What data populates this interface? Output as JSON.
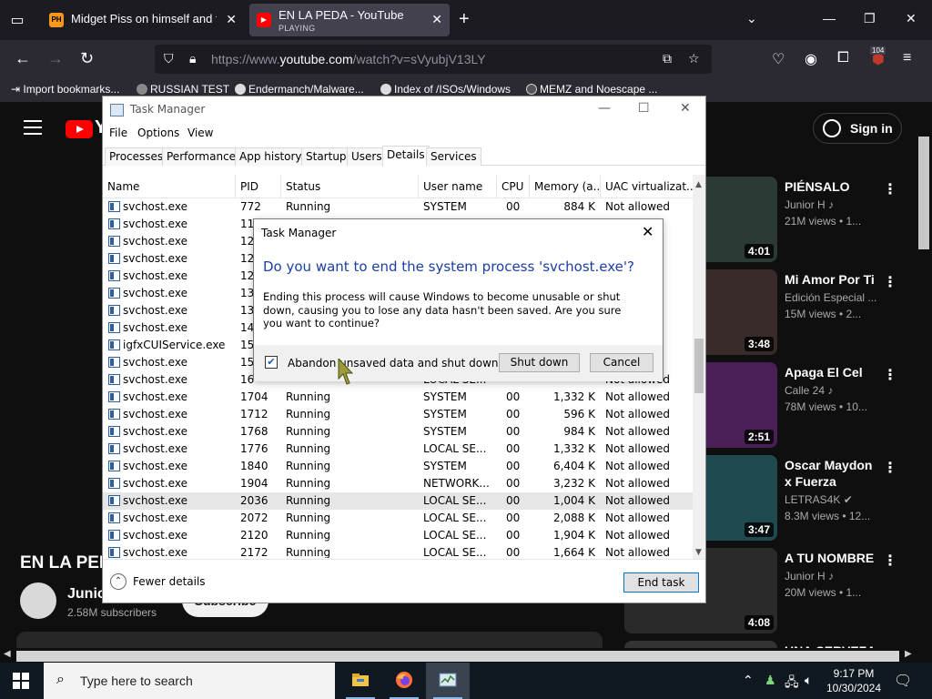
{
  "browser": {
    "tabs": [
      {
        "title": "Midget Piss on himself and their",
        "favicon": "PH",
        "playing": ""
      },
      {
        "title": "EN LA PEDA - YouTube",
        "favicon": "yt",
        "playing": "PLAYING"
      }
    ],
    "url_prefix": "https://www.",
    "url_domain": "youtube.com",
    "url_path": "/watch?v=sVyubjV13LY",
    "extension_badge": "104",
    "bookmarks": [
      "Import bookmarks...",
      "RUSSIAN TEST",
      "Endermanch/Malware...",
      "Index of /ISOs/Windows",
      "MEMZ and Noescape ..."
    ]
  },
  "youtube": {
    "sign_in": "Sign in",
    "video_title": "EN LA PEDA",
    "channel_name": "Junior H",
    "channel_subs": "2.58M subscribers",
    "subscribe": "Subscribe",
    "recommendations": [
      {
        "title": "PIÉNSALO",
        "channel": "Junior H ♪",
        "stats": "21M views • 1...",
        "duration": "4:01",
        "color": "#2c3a36"
      },
      {
        "title": "Mi Amor Por Ti",
        "channel": "Edición Especial ...",
        "stats": "15M views • 2...",
        "duration": "3:48",
        "color": "#3a2b2b"
      },
      {
        "title": "Apaga El Cel",
        "channel": "Calle 24 ♪",
        "stats": "78M views • 10...",
        "duration": "2:51",
        "color": "#4a1f55"
      },
      {
        "title": "Oscar Maydon x Fuerza Regi...",
        "channel": "LETRAS4K ✔",
        "stats": "8.3M views • 12...",
        "duration": "3:47",
        "color": "#1f4a4f"
      },
      {
        "title": "A TU NOMBRE",
        "channel": "Junior H ♪",
        "stats": "20M views • 1...",
        "duration": "4:08",
        "color": "#2a2a2a"
      },
      {
        "title": "UNA CERVEZA",
        "channel": "",
        "stats": "",
        "duration": "",
        "color": "#333"
      }
    ]
  },
  "taskmanager": {
    "title": "Task Manager",
    "menu": [
      "File",
      "Options",
      "View"
    ],
    "tabs": [
      "Processes",
      "Performance",
      "App history",
      "Startup",
      "Users",
      "Details",
      "Services"
    ],
    "selected_tab": "Details",
    "columns": [
      "Name",
      "PID",
      "Status",
      "User name",
      "CPU",
      "Memory (a...",
      "UAC virtualizat..."
    ],
    "rows": [
      {
        "name": "svchost.exe",
        "pid": "772",
        "status": "Running",
        "user": "SYSTEM",
        "cpu": "00",
        "mem": "884 K",
        "uac": "Not allowed"
      },
      {
        "name": "svchost.exe",
        "pid": "11",
        "status": "",
        "user": "",
        "cpu": "",
        "mem": "",
        "uac": ""
      },
      {
        "name": "svchost.exe",
        "pid": "12",
        "status": "",
        "user": "",
        "cpu": "",
        "mem": "",
        "uac": ""
      },
      {
        "name": "svchost.exe",
        "pid": "12",
        "status": "",
        "user": "",
        "cpu": "",
        "mem": "",
        "uac": ""
      },
      {
        "name": "svchost.exe",
        "pid": "12",
        "status": "",
        "user": "",
        "cpu": "",
        "mem": "",
        "uac": ""
      },
      {
        "name": "svchost.exe",
        "pid": "13",
        "status": "",
        "user": "",
        "cpu": "",
        "mem": "",
        "uac": ""
      },
      {
        "name": "svchost.exe",
        "pid": "13",
        "status": "",
        "user": "",
        "cpu": "",
        "mem": "",
        "uac": ""
      },
      {
        "name": "svchost.exe",
        "pid": "14",
        "status": "",
        "user": "",
        "cpu": "",
        "mem": "",
        "uac": ""
      },
      {
        "name": "igfxCUIService.exe",
        "pid": "15",
        "status": "",
        "user": "",
        "cpu": "",
        "mem": "",
        "uac": ""
      },
      {
        "name": "svchost.exe",
        "pid": "15",
        "status": "",
        "user": "",
        "cpu": "",
        "mem": "",
        "uac": ""
      },
      {
        "name": "svchost.exe",
        "pid": "16",
        "status": "",
        "user": "LOCAL SE...",
        "cpu": "",
        "mem": "",
        "uac": "Not allowed"
      },
      {
        "name": "svchost.exe",
        "pid": "1704",
        "status": "Running",
        "user": "SYSTEM",
        "cpu": "00",
        "mem": "1,332 K",
        "uac": "Not allowed"
      },
      {
        "name": "svchost.exe",
        "pid": "1712",
        "status": "Running",
        "user": "SYSTEM",
        "cpu": "00",
        "mem": "596 K",
        "uac": "Not allowed"
      },
      {
        "name": "svchost.exe",
        "pid": "1768",
        "status": "Running",
        "user": "SYSTEM",
        "cpu": "00",
        "mem": "984 K",
        "uac": "Not allowed"
      },
      {
        "name": "svchost.exe",
        "pid": "1776",
        "status": "Running",
        "user": "LOCAL SE...",
        "cpu": "00",
        "mem": "1,332 K",
        "uac": "Not allowed"
      },
      {
        "name": "svchost.exe",
        "pid": "1840",
        "status": "Running",
        "user": "SYSTEM",
        "cpu": "00",
        "mem": "6,404 K",
        "uac": "Not allowed"
      },
      {
        "name": "svchost.exe",
        "pid": "1904",
        "status": "Running",
        "user": "NETWORK...",
        "cpu": "00",
        "mem": "3,232 K",
        "uac": "Not allowed"
      },
      {
        "name": "svchost.exe",
        "pid": "2036",
        "status": "Running",
        "user": "LOCAL SE...",
        "cpu": "00",
        "mem": "1,004 K",
        "uac": "Not allowed"
      },
      {
        "name": "svchost.exe",
        "pid": "2072",
        "status": "Running",
        "user": "LOCAL SE...",
        "cpu": "00",
        "mem": "2,088 K",
        "uac": "Not allowed"
      },
      {
        "name": "svchost.exe",
        "pid": "2120",
        "status": "Running",
        "user": "LOCAL SE...",
        "cpu": "00",
        "mem": "1,904 K",
        "uac": "Not allowed"
      },
      {
        "name": "svchost.exe",
        "pid": "2172",
        "status": "Running",
        "user": "LOCAL SE...",
        "cpu": "00",
        "mem": "1,664 K",
        "uac": "Not allowed"
      }
    ],
    "selected_pid": "2036",
    "fewer_details": "Fewer details",
    "end_task": "End task"
  },
  "dialog": {
    "title": "Task Manager",
    "heading": "Do you want to end the system process 'svchost.exe'?",
    "body": "Ending this process will cause Windows to become unusable or shut down, causing you to lose any data hasn't been saved. Are you sure you want to continue?",
    "checkbox_label": "Abandon unsaved data and shut down.",
    "checkbox_checked": true,
    "shutdown": "Shut down",
    "cancel": "Cancel"
  },
  "taskbar": {
    "search_placeholder": "Type here to search",
    "time": "9:17 PM",
    "date": "10/30/2024"
  }
}
